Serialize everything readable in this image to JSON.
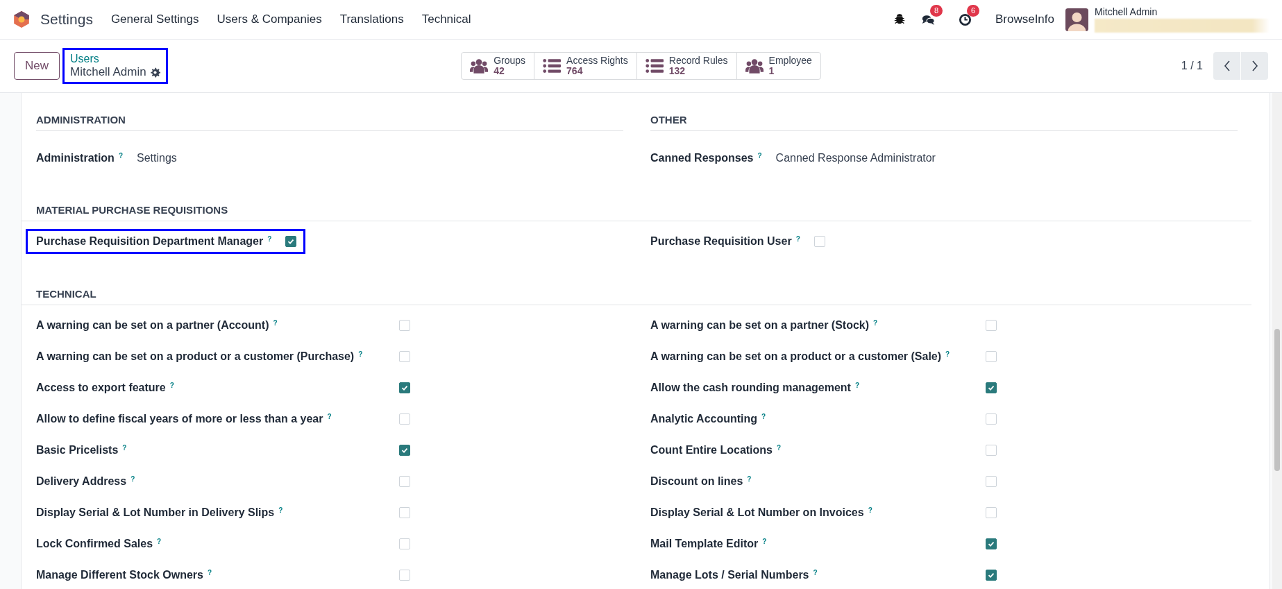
{
  "navbar": {
    "app_name": "Settings",
    "menu": [
      "General Settings",
      "Users & Companies",
      "Translations",
      "Technical"
    ],
    "systray": {
      "messages_count": "8",
      "activities_count": "6",
      "company": "BrowseInfo",
      "user": "Mitchell Admin"
    }
  },
  "control_panel": {
    "new_button": "New",
    "breadcrumb": {
      "parent": "Users",
      "current": "Mitchell Admin",
      "highlighted": true
    },
    "smart_buttons": [
      {
        "kind": "users",
        "label": "Groups",
        "value": "42"
      },
      {
        "kind": "list",
        "label": "Access Rights",
        "value": "764"
      },
      {
        "kind": "list",
        "label": "Record Rules",
        "value": "132"
      },
      {
        "kind": "users",
        "label": "Employee",
        "value": "1"
      }
    ],
    "pager": "1 / 1"
  },
  "section_rows": [
    [
      {
        "title": "ADMINISTRATION",
        "kind": "inline",
        "fields": [
          {
            "kind": "selection",
            "label": "Administration",
            "help": "?",
            "value": "Settings",
            "highlighted": false
          }
        ]
      },
      {
        "title": "OTHER",
        "kind": "inline",
        "fields": [
          {
            "kind": "selection",
            "label": "Canned Responses",
            "help": "?",
            "value": "Canned Response Administrator",
            "highlighted": false
          }
        ]
      }
    ],
    [
      {
        "title": "MATERIAL PURCHASE REQUISITIONS",
        "kind": "inline",
        "fields": [
          {
            "kind": "checkbox",
            "label": "Purchase Requisition Department Manager",
            "help": "?",
            "checked": true,
            "highlighted": true
          },
          {
            "kind": "checkbox",
            "label": "Purchase Requisition User",
            "help": "?",
            "checked": false,
            "highlighted": false
          }
        ]
      }
    ],
    [
      {
        "title": "TECHNICAL",
        "kind": "aligned",
        "fields": [
          {
            "kind": "checkbox",
            "label": "A warning can be set on a partner (Account)",
            "help": "?",
            "checked": false,
            "highlighted": false
          },
          {
            "kind": "checkbox",
            "label": "A warning can be set on a partner (Stock)",
            "help": "?",
            "checked": false,
            "highlighted": false
          },
          {
            "kind": "checkbox",
            "label": "A warning can be set on a product or a customer (Purchase)",
            "help": "?",
            "checked": false,
            "highlighted": false
          },
          {
            "kind": "checkbox",
            "label": "A warning can be set on a product or a customer (Sale)",
            "help": "?",
            "checked": false,
            "highlighted": false
          },
          {
            "kind": "checkbox",
            "label": "Access to export feature",
            "help": "?",
            "checked": true,
            "highlighted": false
          },
          {
            "kind": "checkbox",
            "label": "Allow the cash rounding management",
            "help": "?",
            "checked": true,
            "highlighted": false
          },
          {
            "kind": "checkbox",
            "label": "Allow to define fiscal years of more or less than a year",
            "help": "?",
            "checked": false,
            "highlighted": false
          },
          {
            "kind": "checkbox",
            "label": "Analytic Accounting",
            "help": "?",
            "checked": false,
            "highlighted": false
          },
          {
            "kind": "checkbox",
            "label": "Basic Pricelists",
            "help": "?",
            "checked": true,
            "highlighted": false
          },
          {
            "kind": "checkbox",
            "label": "Count Entire Locations",
            "help": "?",
            "checked": false,
            "highlighted": false
          },
          {
            "kind": "checkbox",
            "label": "Delivery Address",
            "help": "?",
            "checked": false,
            "highlighted": false
          },
          {
            "kind": "checkbox",
            "label": "Discount on lines",
            "help": "?",
            "checked": false,
            "highlighted": false
          },
          {
            "kind": "checkbox",
            "label": "Display Serial & Lot Number in Delivery Slips",
            "help": "?",
            "checked": false,
            "highlighted": false
          },
          {
            "kind": "checkbox",
            "label": "Display Serial & Lot Number on Invoices",
            "help": "?",
            "checked": false,
            "highlighted": false
          },
          {
            "kind": "checkbox",
            "label": "Lock Confirmed Sales",
            "help": "?",
            "checked": false,
            "highlighted": false
          },
          {
            "kind": "checkbox",
            "label": "Mail Template Editor",
            "help": "?",
            "checked": true,
            "highlighted": false
          },
          {
            "kind": "checkbox",
            "label": "Manage Different Stock Owners",
            "help": "?",
            "checked": false,
            "highlighted": false
          },
          {
            "kind": "checkbox",
            "label": "Manage Lots / Serial Numbers",
            "help": "?",
            "checked": true,
            "highlighted": false
          }
        ]
      }
    ]
  ]
}
